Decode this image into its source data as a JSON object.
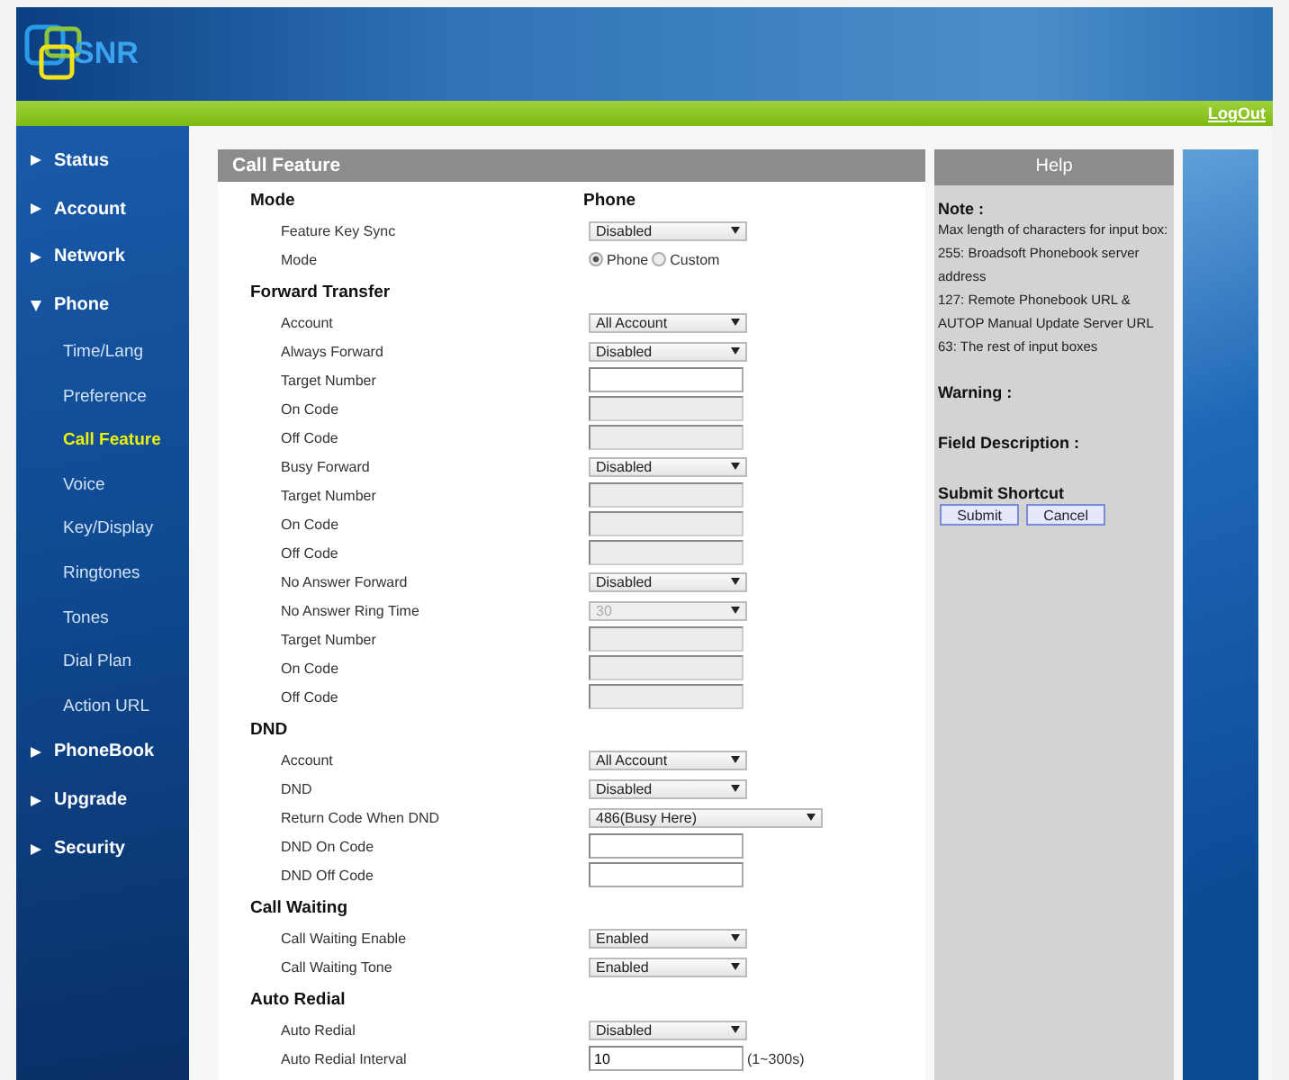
{
  "header": {
    "logo": "SNR",
    "logout": "LogOut"
  },
  "sidebar": {
    "items": [
      {
        "label": "Status",
        "expanded": false,
        "selected": false
      },
      {
        "label": "Account",
        "expanded": false,
        "selected": false
      },
      {
        "label": "Network",
        "expanded": false,
        "selected": false
      },
      {
        "label": "Phone",
        "expanded": true,
        "selected": false,
        "children": [
          {
            "label": "Time/Lang",
            "selected": false
          },
          {
            "label": "Preference",
            "selected": false
          },
          {
            "label": "Call Feature",
            "selected": true
          },
          {
            "label": "Voice",
            "selected": false
          },
          {
            "label": "Key/Display",
            "selected": false
          },
          {
            "label": "Ringtones",
            "selected": false
          },
          {
            "label": "Tones",
            "selected": false
          },
          {
            "label": "Dial Plan",
            "selected": false
          },
          {
            "label": "Action URL",
            "selected": false
          }
        ]
      },
      {
        "label": "PhoneBook",
        "expanded": false,
        "selected": false
      },
      {
        "label": "Upgrade",
        "expanded": false,
        "selected": false
      },
      {
        "label": "Security",
        "expanded": false,
        "selected": false
      }
    ]
  },
  "panel": {
    "title": "Call Feature",
    "sections": [
      {
        "title": "Mode",
        "column_heading": "Phone",
        "rows": [
          {
            "label": "Feature Key Sync",
            "kind": "select",
            "value": "Disabled",
            "disabled": false
          },
          {
            "label": "Mode",
            "kind": "radio",
            "options": [
              {
                "label": "Phone",
                "selected": true
              },
              {
                "label": "Custom",
                "selected": false
              }
            ]
          }
        ]
      },
      {
        "title": "Forward Transfer",
        "rows": [
          {
            "label": "Account",
            "kind": "select",
            "value": "All Account",
            "disabled": false
          },
          {
            "label": "Always Forward",
            "kind": "select",
            "value": "Disabled",
            "disabled": false
          },
          {
            "label": "Target Number",
            "kind": "text",
            "disabled": false
          },
          {
            "label": "On Code",
            "kind": "text",
            "disabled": true
          },
          {
            "label": "Off Code",
            "kind": "text",
            "disabled": true
          },
          {
            "label": "Busy Forward",
            "kind": "select",
            "value": "Disabled",
            "disabled": false
          },
          {
            "label": "Target Number",
            "kind": "text",
            "disabled": true
          },
          {
            "label": "On Code",
            "kind": "text",
            "disabled": true
          },
          {
            "label": "Off Code",
            "kind": "text",
            "disabled": true
          },
          {
            "label": "No Answer Forward",
            "kind": "select",
            "value": "Disabled",
            "disabled": false
          },
          {
            "label": "No Answer Ring Time",
            "kind": "select",
            "value": "30",
            "disabled": true
          },
          {
            "label": "Target Number",
            "kind": "text",
            "disabled": true
          },
          {
            "label": "On Code",
            "kind": "text",
            "disabled": true
          },
          {
            "label": "Off Code",
            "kind": "text",
            "disabled": true
          }
        ]
      },
      {
        "title": "DND",
        "rows": [
          {
            "label": "Account",
            "kind": "select",
            "value": "All Account",
            "disabled": false
          },
          {
            "label": "DND",
            "kind": "select",
            "value": "Disabled",
            "disabled": false
          },
          {
            "label": "Return Code When DND",
            "kind": "wide-select",
            "value": "486(Busy Here)",
            "disabled": false
          },
          {
            "label": "DND On Code",
            "kind": "text",
            "disabled": false
          },
          {
            "label": "DND Off Code",
            "kind": "text",
            "disabled": false
          }
        ]
      },
      {
        "title": "Call Waiting",
        "rows": [
          {
            "label": "Call Waiting Enable",
            "kind": "select",
            "value": "Enabled",
            "disabled": false
          },
          {
            "label": "Call Waiting Tone",
            "kind": "select",
            "value": "Enabled",
            "disabled": false
          }
        ]
      },
      {
        "title": "Auto Redial",
        "rows": [
          {
            "label": "Auto Redial",
            "kind": "select",
            "value": "Disabled",
            "disabled": false
          },
          {
            "label": "Auto Redial Interval",
            "kind": "text",
            "value": "10",
            "suffix": "(1~300s)",
            "disabled": false
          }
        ]
      }
    ]
  },
  "help": {
    "title": "Help",
    "note_heading": "Note :",
    "note_lines": [
      "Max length of characters for input box:",
      "255: Broadsoft Phonebook server address",
      "127: Remote Phonebook URL & AUTOP Manual Update Server URL",
      "63: The rest of input boxes"
    ],
    "warning_heading": "Warning :",
    "field_description_heading": "Field Description :",
    "shortcut_heading": "Submit Shortcut",
    "buttons": [
      "Submit",
      "Cancel"
    ]
  }
}
